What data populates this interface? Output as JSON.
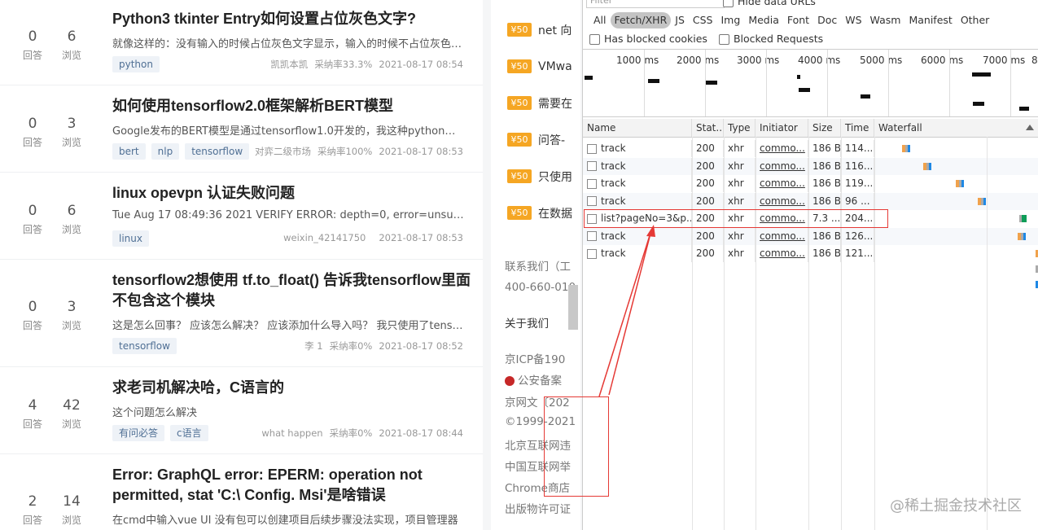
{
  "questions": [
    {
      "answers": "0",
      "answers_label": "回答",
      "views": "6",
      "views_label": "浏览",
      "title": "Python3 tkinter Entry如何设置占位灰色文字?",
      "desc": "就像这样的：没有输入的时候占位灰色文字显示，输入的时候不占位灰色文字消失",
      "tags": [
        "python"
      ],
      "author": "凯凯本凯",
      "rate": "采纳率33.3%",
      "time": "2021-08-17 08:54"
    },
    {
      "answers": "0",
      "answers_label": "回答",
      "views": "3",
      "views_label": "浏览",
      "title": "如何使用tensorflow2.0框架解析BERT模型",
      "desc": "Google发布的BERT模型是通过tensorflow1.0开发的，我这种python新手",
      "tags": [
        "bert",
        "nlp",
        "tensorflow"
      ],
      "author": "对弈二级市场",
      "rate": "采纳率100%",
      "time": "2021-08-17 08:53"
    },
    {
      "answers": "0",
      "answers_label": "回答",
      "views": "6",
      "views_label": "浏览",
      "title": "linux opevpn 认证失败问题",
      "desc": "Tue Aug 17 08:49:36 2021 VERIFY ERROR: depth=0, error=unsupported",
      "tags": [
        "linux"
      ],
      "author": "weixin_42141750",
      "rate": "",
      "time": "2021-08-17 08:53"
    },
    {
      "answers": "0",
      "answers_label": "回答",
      "views": "3",
      "views_label": "浏览",
      "title": "tensorflow2想使用 tf.to_float() 告诉我tensorflow里面不包含这个模块",
      "desc": "这是怎么回事？ 应该怎么解决？ 应该添加什么导入吗？ 我只使用了tensorflow",
      "tags": [
        "tensorflow"
      ],
      "author": "李 1",
      "rate": "采纳率0%",
      "time": "2021-08-17 08:52"
    },
    {
      "answers": "4",
      "answers_label": "回答",
      "views": "42",
      "views_label": "浏览",
      "title": "求老司机解决哈，C语言的",
      "desc": "这个问题怎么解决",
      "tags": [
        "有问必答",
        "c语言"
      ],
      "author": "what happen",
      "rate": "采纳率0%",
      "time": "2021-08-17 08:44"
    },
    {
      "answers": "2",
      "answers_label": "回答",
      "views": "14",
      "views_label": "浏览",
      "title": "Error: GraphQL error: EPERM: operation not permitted, stat 'C:\\ Config. Msi'是啥错误",
      "desc": "在cmd中输入vue UI 没有包可以创建项目后续步骤没法实现，项目管理器",
      "tags": [],
      "author": "",
      "rate": "",
      "time": ""
    }
  ],
  "bounties": [
    {
      "badge": "¥50",
      "text": "net 向"
    },
    {
      "badge": "¥50",
      "text": "VMwa"
    },
    {
      "badge": "¥50",
      "text": "需要在"
    },
    {
      "badge": "¥50",
      "text": "问答-"
    },
    {
      "badge": "¥50",
      "text": "只使用"
    },
    {
      "badge": "¥50",
      "text": "在数据"
    }
  ],
  "footer": {
    "contact": "联系我们（工",
    "phone": "400-660-010",
    "about": "关于我们",
    "icp": "京ICP备190",
    "police": "公安备案",
    "culture": "京网文〔202",
    "copyright": "©1999-2021",
    "beijing": "北京互联网违",
    "china": "中国互联网举",
    "chrome": "Chrome商店",
    "publish": "出版物许可证"
  },
  "devtools": {
    "filter_placeholder": "Filter",
    "hide_data_urls": "Hide data URLs",
    "types": [
      "All",
      "Fetch/XHR",
      "JS",
      "CSS",
      "Img",
      "Media",
      "Font",
      "Doc",
      "WS",
      "Wasm",
      "Manifest",
      "Other"
    ],
    "selected_type": "Fetch/XHR",
    "has_blocked_cookies": "Has blocked cookies",
    "blocked_requests": "Blocked Requests",
    "ticks": [
      "1000 ms",
      "2000 ms",
      "3000 ms",
      "4000 ms",
      "5000 ms",
      "6000 ms",
      "7000 ms",
      "8"
    ],
    "columns": [
      "Name",
      "Stat...",
      "Type",
      "Initiator",
      "Size",
      "Time",
      "Waterfall"
    ],
    "rows": [
      {
        "name": "track",
        "status": "200",
        "type": "xhr",
        "initiator": "commo...",
        "size": "186 B",
        "time": "114..."
      },
      {
        "name": "track",
        "status": "200",
        "type": "xhr",
        "initiator": "commo...",
        "size": "186 B",
        "time": "116..."
      },
      {
        "name": "track",
        "status": "200",
        "type": "xhr",
        "initiator": "commo...",
        "size": "186 B",
        "time": "119..."
      },
      {
        "name": "track",
        "status": "200",
        "type": "xhr",
        "initiator": "commo...",
        "size": "186 B",
        "time": "96 ..."
      },
      {
        "name": "list?pageNo=3&p...",
        "status": "200",
        "type": "xhr",
        "initiator": "commo...",
        "size": "7.3 ...",
        "time": "204..."
      },
      {
        "name": "track",
        "status": "200",
        "type": "xhr",
        "initiator": "commo...",
        "size": "186 B",
        "time": "126..."
      },
      {
        "name": "track",
        "status": "200",
        "type": "xhr",
        "initiator": "commo...",
        "size": "186 B",
        "time": "121..."
      }
    ]
  },
  "watermark": "@稀土掘金技术社区",
  "colors": {
    "accent_red": "#e53935",
    "badge_orange": "#f5a623",
    "tag_bg": "#eef2f7",
    "tag_text": "#4f6f94"
  }
}
